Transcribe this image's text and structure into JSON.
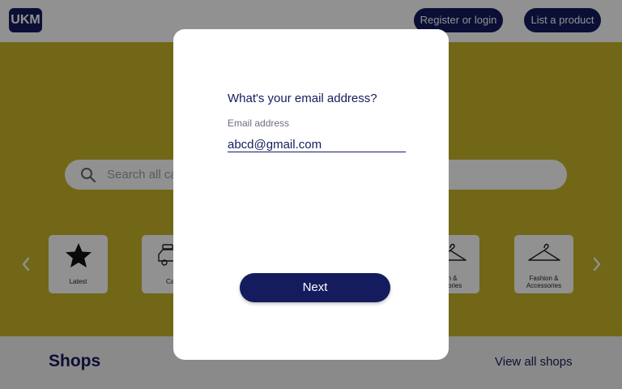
{
  "header": {
    "logo_text": "UKM",
    "register_label": "Register or login",
    "list_product_label": "List a product"
  },
  "search": {
    "placeholder": "Search all ca"
  },
  "categories": [
    {
      "label": "Latest",
      "icon": "star-icon"
    },
    {
      "label": "Car",
      "icon": "car-icon"
    },
    {
      "label": "ion &\nessories",
      "icon": "hanger-icon"
    },
    {
      "label": "Fashion &\nAccessories",
      "icon": "hanger-icon"
    }
  ],
  "shops": {
    "title": "Shops",
    "view_all_label": "View all shops"
  },
  "modal": {
    "question": "What's your email address?",
    "field_label": "Email address",
    "email_value": "abcd@gmail.com",
    "next_label": "Next"
  },
  "colors": {
    "brand": "#141c5e",
    "hero": "#c7b52a",
    "overlay": "rgba(0,0,0,0.43)"
  }
}
